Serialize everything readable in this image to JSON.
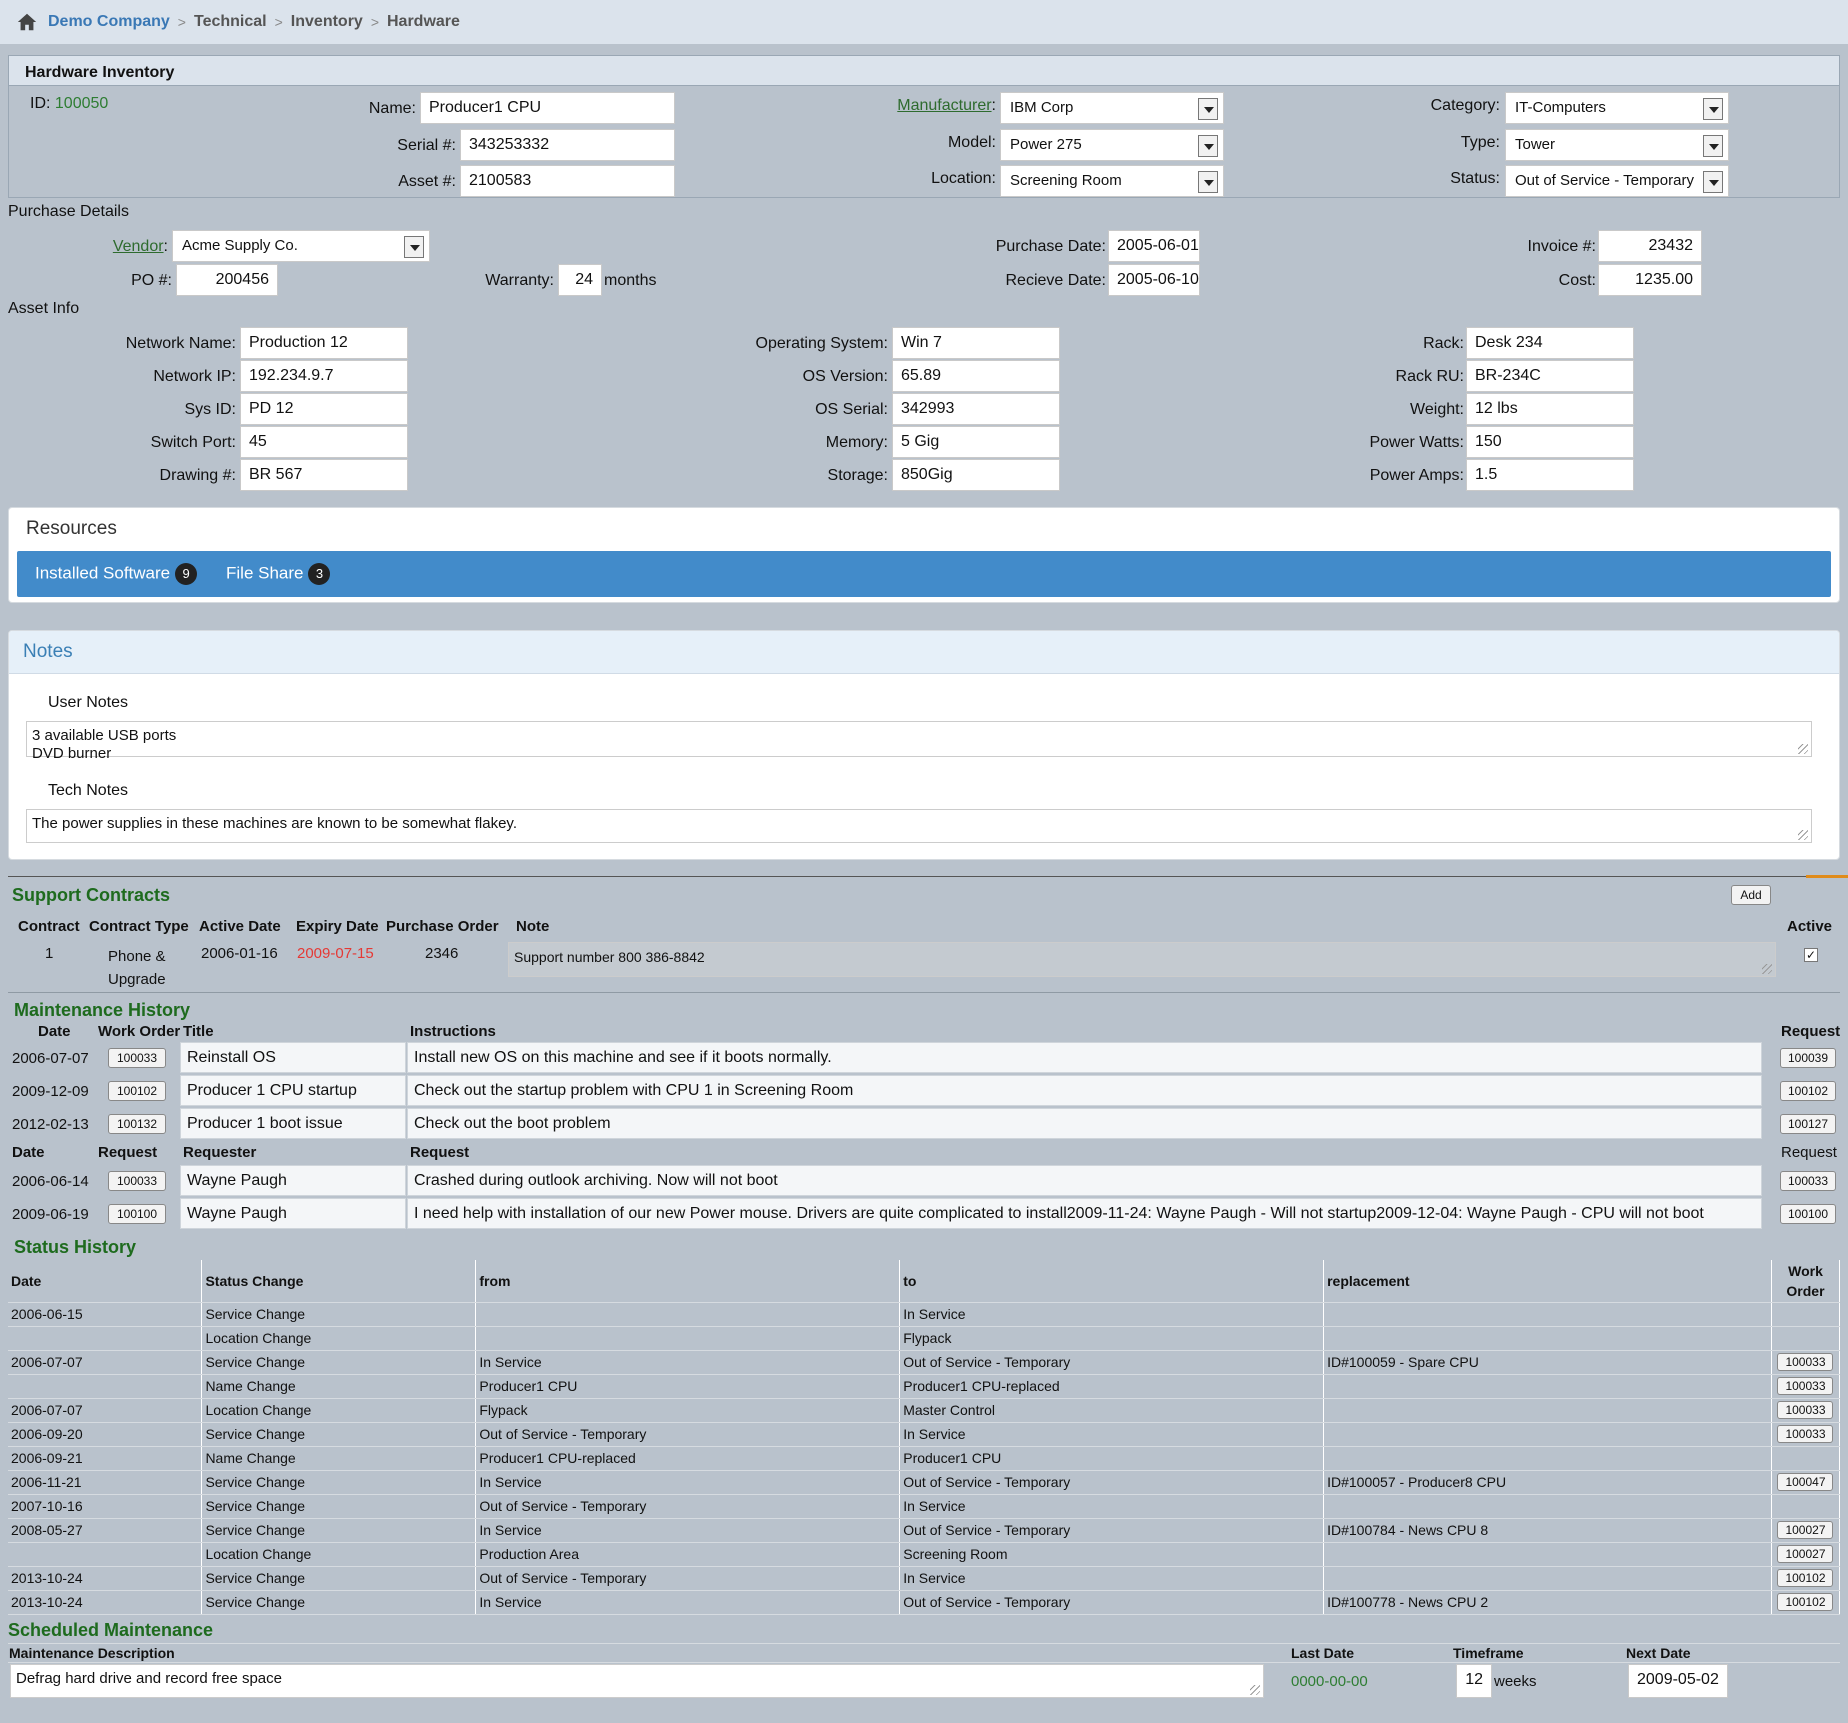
{
  "breadcrumb": {
    "items": [
      "Demo Company",
      "Technical",
      "Inventory",
      "Hardware"
    ]
  },
  "hardware": {
    "title": "Hardware Inventory",
    "id_label": "ID:",
    "id_value": "100050",
    "name_label": "Name:",
    "name": "Producer1 CPU",
    "serial_label": "Serial #:",
    "serial": "343253332",
    "asset_label": "Asset #:",
    "asset": "2100583",
    "manufacturer_label": "Manufacturer",
    "manufacturer": "IBM Corp",
    "model_label": "Model:",
    "model": "Power 275",
    "location_label": "Location:",
    "location": "Screening Room",
    "category_label": "Category:",
    "category": "IT-Computers",
    "type_label": "Type:",
    "type": "Tower",
    "status_label": "Status:",
    "status": "Out of Service - Temporary"
  },
  "purchase": {
    "title": "Purchase Details",
    "vendor_label": "Vendor",
    "vendor": "Acme Supply Co.",
    "po_label": "PO #:",
    "po": "200456",
    "warranty_label": "Warranty:",
    "warranty": "24",
    "warranty_unit": "months",
    "purchase_date_label": "Purchase Date:",
    "purchase_date": "2005-06-01",
    "receive_date_label": "Recieve Date:",
    "receive_date": "2005-06-10",
    "invoice_label": "Invoice #:",
    "invoice": "23432",
    "cost_label": "Cost:",
    "cost": "1235.00"
  },
  "asset_info": {
    "title": "Asset Info",
    "col1": [
      {
        "label": "Network Name:",
        "value": "Production 12"
      },
      {
        "label": "Network IP:",
        "value": "192.234.9.7"
      },
      {
        "label": "Sys ID:",
        "value": "PD 12"
      },
      {
        "label": "Switch Port:",
        "value": "45"
      },
      {
        "label": "Drawing #:",
        "value": "BR 567"
      }
    ],
    "col2": [
      {
        "label": "Operating System:",
        "value": "Win 7"
      },
      {
        "label": "OS Version:",
        "value": "65.89"
      },
      {
        "label": "OS Serial:",
        "value": "342993"
      },
      {
        "label": "Memory:",
        "value": "5 Gig"
      },
      {
        "label": "Storage:",
        "value": "850Gig"
      }
    ],
    "col3": [
      {
        "label": "Rack:",
        "value": "Desk 234"
      },
      {
        "label": "Rack RU:",
        "value": "BR-234C"
      },
      {
        "label": "Weight:",
        "value": "12 lbs"
      },
      {
        "label": "Power Watts:",
        "value": "150"
      },
      {
        "label": "Power Amps:",
        "value": "1.5"
      }
    ]
  },
  "resources": {
    "title": "Resources",
    "tabs": [
      {
        "label": "Installed Software",
        "count": "9"
      },
      {
        "label": "File Share",
        "count": "3"
      }
    ]
  },
  "notes": {
    "title": "Notes",
    "user_label": "User Notes",
    "user_text": "3 available USB ports\nDVD burner",
    "tech_label": "Tech Notes",
    "tech_text": "The power supplies in these machines are known to be somewhat flakey."
  },
  "contracts": {
    "title": "Support Contracts",
    "add_label": "Add",
    "headers": [
      "Contract",
      "Contract Type",
      "Active Date",
      "Expiry Date",
      "Purchase Order",
      "Note",
      "Active"
    ],
    "row": {
      "contract": "1",
      "type": "Phone &\nUpgrade",
      "active_date": "2006-01-16",
      "expiry_date": "2009-07-15",
      "po": "2346",
      "note": "Support number 800 386-8842",
      "active": "✓"
    }
  },
  "maintenance": {
    "title": "Maintenance History",
    "headers": [
      "Date",
      "Work Order",
      "Title",
      "Instructions",
      "Request"
    ],
    "rows": [
      {
        "date": "2006-07-07",
        "wo": "100033",
        "title": "Reinstall OS",
        "instr": "Install new OS on this machine and see if it boots normally.",
        "req": "100039"
      },
      {
        "date": "2009-12-09",
        "wo": "100102",
        "title": "Producer 1 CPU startup",
        "instr": "Check out the startup problem with CPU 1 in Screening Room",
        "req": "100102"
      },
      {
        "date": "2012-02-13",
        "wo": "100132",
        "title": "Producer 1 boot issue",
        "instr": "Check out the boot problem",
        "req": "100127"
      }
    ],
    "req_headers": [
      "Date",
      "Request",
      "Requester",
      "Request",
      "Request"
    ],
    "req_rows": [
      {
        "date": "2006-06-14",
        "req": "100033",
        "requester": "Wayne Paugh",
        "text": "Crashed during outlook archiving. Now will not boot",
        "req2": "100033"
      },
      {
        "date": "2009-06-19",
        "req": "100100",
        "requester": "Wayne Paugh",
        "text": "I need help with installation of our new Power mouse. Drivers are quite complicated to install2009-11-24: Wayne Paugh - Will not startup2009-12-04: Wayne Paugh - CPU will not boot",
        "req2": "100100"
      }
    ]
  },
  "status_history": {
    "title": "Status History",
    "headers": [
      "Date",
      "Status Change",
      "from",
      "to",
      "replacement",
      "Work\nOrder"
    ],
    "rows": [
      [
        "2006-06-15",
        "Service Change",
        "",
        "In Service",
        "",
        ""
      ],
      [
        "",
        "Location Change",
        "",
        "Flypack",
        "",
        ""
      ],
      [
        "2006-07-07",
        "Service Change",
        "In Service",
        "Out of Service - Temporary",
        "ID#100059 - Spare CPU",
        "100033"
      ],
      [
        "",
        "Name Change",
        "Producer1 CPU",
        "Producer1 CPU-replaced",
        "",
        "100033"
      ],
      [
        "2006-07-07",
        "Location Change",
        "Flypack",
        "Master Control",
        "",
        "100033"
      ],
      [
        "2006-09-20",
        "Service Change",
        "Out of Service - Temporary",
        "In Service",
        "",
        "100033"
      ],
      [
        "2006-09-21",
        "Name Change",
        "Producer1 CPU-replaced",
        "Producer1 CPU",
        "",
        ""
      ],
      [
        "2006-11-21",
        "Service Change",
        "In Service",
        "Out of Service - Temporary",
        "ID#100057 - Producer8 CPU",
        "100047"
      ],
      [
        "2007-10-16",
        "Service Change",
        "Out of Service - Temporary",
        "In Service",
        "",
        ""
      ],
      [
        "2008-05-27",
        "Service Change",
        "In Service",
        "Out of Service - Temporary",
        "ID#100784 - News CPU 8",
        "100027"
      ],
      [
        "",
        "Location Change",
        "Production Area",
        "Screening Room",
        "",
        "100027"
      ],
      [
        "2013-10-24",
        "Service Change",
        "Out of Service - Temporary",
        "In Service",
        "",
        "100102"
      ],
      [
        "2013-10-24",
        "Service Change",
        "In Service",
        "Out of Service - Temporary",
        "ID#100778 - News CPU 2",
        "100102"
      ]
    ]
  },
  "scheduled": {
    "title": "Scheduled Maintenance",
    "headers": [
      "Maintenance Description",
      "Last Date",
      "Timeframe",
      "Next Date"
    ],
    "description": "Defrag hard drive and record free space",
    "last_date": "0000-00-00",
    "timeframe": "12",
    "timeframe_unit": "weeks",
    "next_date": "2009-05-02"
  }
}
